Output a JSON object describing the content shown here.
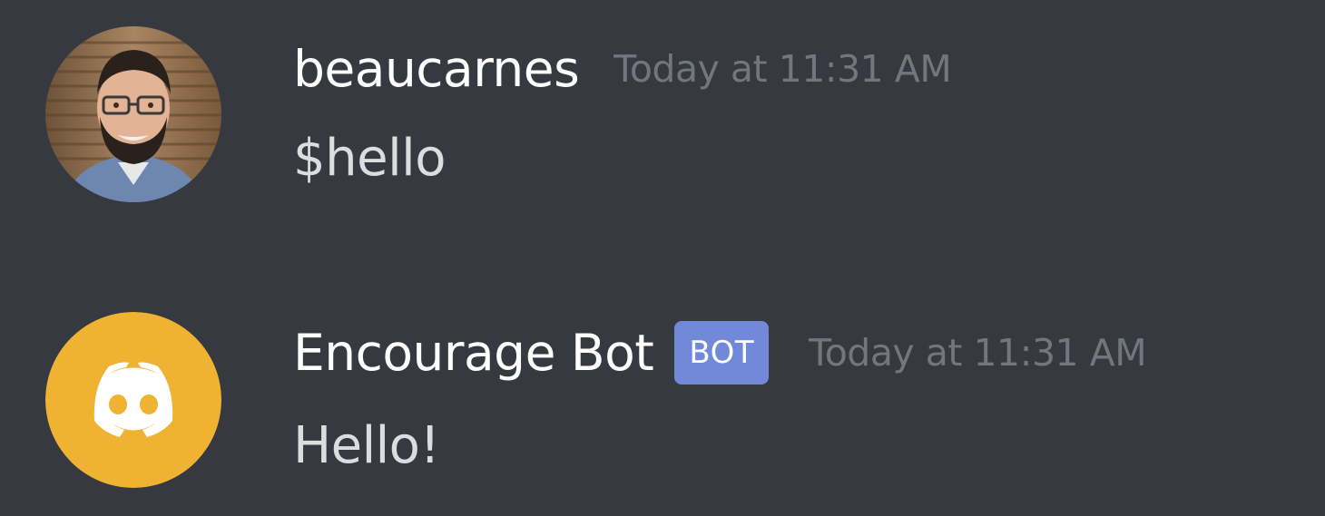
{
  "messages": [
    {
      "author": "beaucarnes",
      "timestamp": "Today at 11:31 AM",
      "content": "$hello",
      "avatar": "user-photo-avatar",
      "is_bot": false
    },
    {
      "author": "Encourage Bot",
      "bot_tag": "BOT",
      "timestamp": "Today at 11:31 AM",
      "content": "Hello!",
      "avatar": "discord-logo-avatar",
      "avatar_color": "#f0b232",
      "is_bot": true
    }
  ],
  "colors": {
    "background": "#36393f",
    "username": "#ffffff",
    "timestamp": "#72767d",
    "message_text": "#dcddde",
    "bot_tag": "#7289da"
  }
}
